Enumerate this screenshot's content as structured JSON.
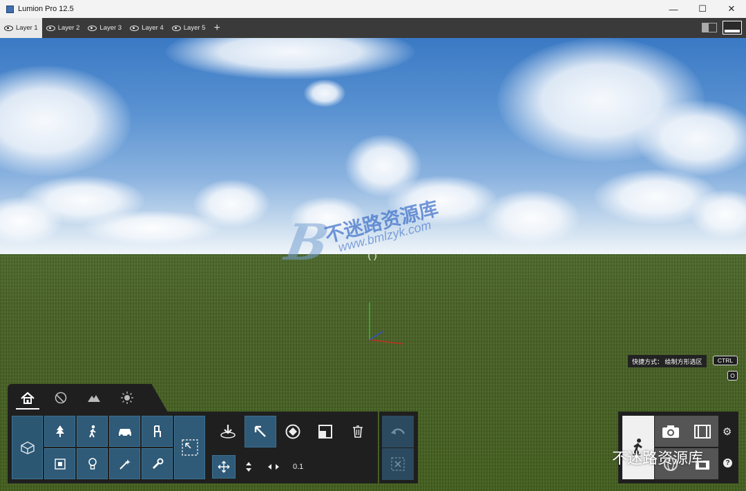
{
  "window": {
    "title": "Lumion Pro 12.5",
    "controls": [
      "minimize-icon",
      "maximize-icon",
      "close-icon"
    ]
  },
  "layers": {
    "tabs": [
      {
        "label": "Layer 1",
        "active": true
      },
      {
        "label": "Layer 2",
        "active": false
      },
      {
        "label": "Layer 3",
        "active": false
      },
      {
        "label": "Layer 4",
        "active": false
      },
      {
        "label": "Layer 5",
        "active": false
      }
    ],
    "add_icon": "plus-icon"
  },
  "watermark": {
    "brand": "不迷路资源库",
    "url": "www.bmlzyk.com",
    "letter": "B"
  },
  "shortcut": {
    "label": "快捷方式：  绘制方形选区",
    "key1": "CTRL",
    "key2": "O"
  },
  "build_panel": {
    "tabs": [
      "home-icon",
      "material-icon",
      "landscape-icon",
      "weather-icon"
    ],
    "field_value": "0.1"
  },
  "bottom_watermark": "不迷路资源库",
  "colors": {
    "tile": "#2f5a78",
    "panel": "#1f1f1f",
    "layerbar": "#3a3a3a"
  }
}
